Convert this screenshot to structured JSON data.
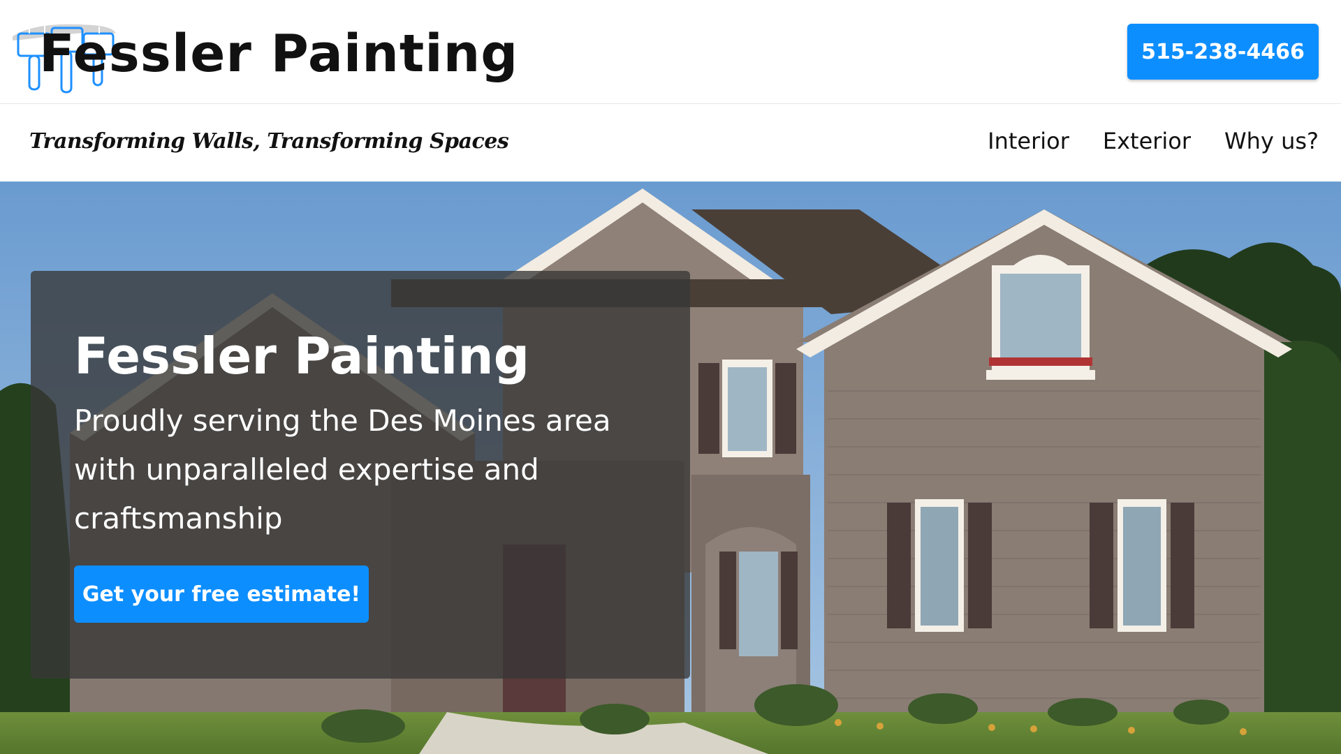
{
  "header": {
    "brand": "Fessler Painting",
    "phone": "515-238-4466"
  },
  "nav": {
    "tagline": "Transforming Walls, Transforming Spaces",
    "links": [
      "Interior",
      "Exterior",
      "Why us?"
    ]
  },
  "hero": {
    "title": "Fessler Painting",
    "subtitle": "Proudly serving the Des Moines area with unparalleled expertise and craftsmanship",
    "cta": "Get your free estimate!"
  },
  "icons": {
    "logo": "paint-brushes-icon"
  },
  "colors": {
    "accent": "#0d8eff",
    "overlay": "#373737",
    "text": "#111111",
    "white": "#ffffff"
  }
}
